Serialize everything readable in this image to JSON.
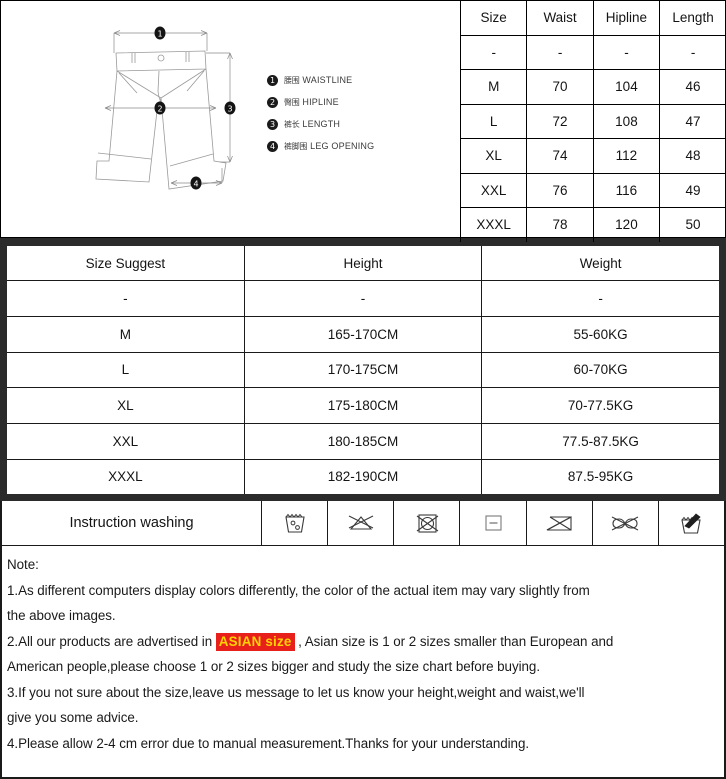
{
  "diagram": {
    "alt": "shorts-measurement-diagram",
    "markers": [
      "1",
      "2",
      "3",
      "4"
    ],
    "legend": [
      {
        "num": "1",
        "cn": "腰围",
        "en": "WAISTLINE"
      },
      {
        "num": "2",
        "cn": "臀围",
        "en": "HIPLINE"
      },
      {
        "num": "3",
        "cn": "裤长",
        "en": "LENGTH"
      },
      {
        "num": "4",
        "cn": "裤脚围",
        "en": "LEG OPENING"
      }
    ]
  },
  "size_table": {
    "headers": [
      "Size",
      "Waist",
      "Hipline",
      "Length"
    ],
    "rows": [
      [
        "-",
        "-",
        "-",
        "-"
      ],
      [
        "M",
        "70",
        "104",
        "46"
      ],
      [
        "L",
        "72",
        "108",
        "47"
      ],
      [
        "XL",
        "74",
        "112",
        "48"
      ],
      [
        "XXL",
        "76",
        "116",
        "49"
      ],
      [
        "XXXL",
        "78",
        "120",
        "50"
      ]
    ]
  },
  "suggest_table": {
    "headers": [
      "Size Suggest",
      "Height",
      "Weight"
    ],
    "rows": [
      [
        "-",
        "-",
        "-"
      ],
      [
        "M",
        "165-170CM",
        "55-60KG"
      ],
      [
        "L",
        "170-175CM",
        "60-70KG"
      ],
      [
        "XL",
        "175-180CM",
        "70-77.5KG"
      ],
      [
        "XXL",
        "180-185CM",
        "77.5-87.5KG"
      ],
      [
        "XXXL",
        "182-190CM",
        "87.5-95KG"
      ]
    ]
  },
  "washing": {
    "label": "Instruction washing",
    "icons": [
      "machine-wash-icon",
      "do-not-dry-in-sunlight-icon",
      "do-not-tumble-dry-icon",
      "flat-dry-icon",
      "do-not-bleach-icon",
      "do-not-wring-icon",
      "hand-wash-icon"
    ]
  },
  "note": {
    "title": "Note:",
    "line1a": "1.As different computers display colors differently, the color of the actual item may vary slightly from",
    "line1b": "the above images.",
    "line2a": "2.All our products are advertised in",
    "line2_highlight": "ASIAN size",
    "line2b": ", Asian size is 1 or 2 sizes smaller than European and",
    "line2c": "American people,please choose 1 or 2 sizes bigger and study the size chart before buying.",
    "line3a": "3.If you not sure about the size,leave us message to let us know your height,weight and waist,we'll",
    "line3b": "give you some advice.",
    "line4": "4.Please allow 2-4 cm error due to manual measurement.Thanks for your understanding."
  },
  "colors": {
    "highlight_bg": "#e8201c",
    "highlight_text": "#ffd400",
    "border": "#1a1a1a",
    "thick_border": "#2b2b2b"
  }
}
